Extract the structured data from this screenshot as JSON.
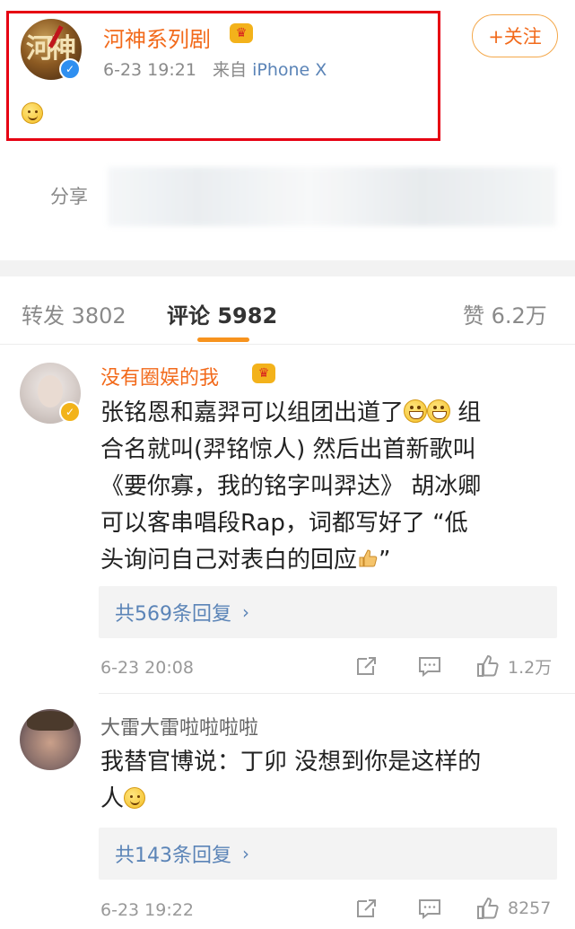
{
  "post": {
    "username": "河神系列剧",
    "time": "6-23 19:21",
    "source_prefix": "来自",
    "source": "iPhone X",
    "follow_label": "+关注",
    "share_label": "分享",
    "emoji": "smiley-icon"
  },
  "tabs": {
    "repost": "转发 3802",
    "comment": "评论 5982",
    "like": "赞 6.2万"
  },
  "comments": [
    {
      "username": "没有圈娱的我",
      "lines": [
        "张铭恩和嘉羿可以组团出道了",
        " 组",
        "合名就叫(羿铭惊人) 然后出首新歌叫",
        "《要你寡，我的铭字叫羿达》 胡冰卿",
        "可以客串唱段Rap，词都写好了 “低",
        "头询问自己对表白的回应",
        "”"
      ],
      "replies": "共569条回复",
      "time": "6-23 20:08",
      "likes": "1.2万"
    },
    {
      "username": "大雷大雷啦啦啦啦",
      "lines": [
        "我替官博说：丁卯  没想到你是这样的",
        "人"
      ],
      "replies": "共143条回复",
      "time": "6-23 19:22",
      "likes": "8257"
    }
  ],
  "colors": {
    "accent": "#f26a1b",
    "link": "#5b84b7",
    "highlight": "#e60012",
    "tab_underline": "#f7931e"
  }
}
